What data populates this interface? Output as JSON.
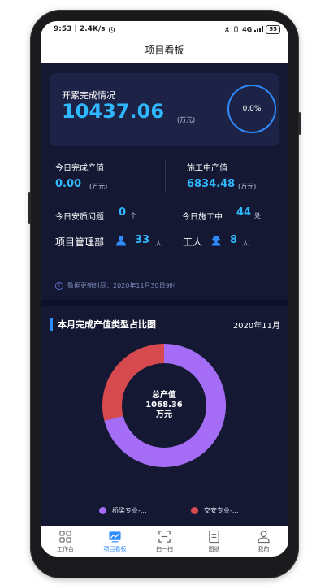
{
  "status_bar": {
    "time": "9:53 | 2.4K/s",
    "alarm_icon": "alarm-icon",
    "network": "4G",
    "battery": "55"
  },
  "title": "项目看板",
  "summary": {
    "label": "开累完成情况",
    "value": "10437.06",
    "unit": "(万元)",
    "percent": "0.0%"
  },
  "stats": {
    "today_output": {
      "label": "今日完成产值",
      "value": "0.00",
      "unit": "(万元)"
    },
    "in_progress_output": {
      "label": "施工中产值",
      "value": "6834.48",
      "unit": "(万元)"
    },
    "safety_issues": {
      "label": "今日安质问题",
      "value": "0",
      "unit": "个"
    },
    "today_construction": {
      "label": "今日施工中",
      "value": "44",
      "unit": "处"
    },
    "management": {
      "label": "项目管理部",
      "value": "33",
      "unit": "人"
    },
    "workers": {
      "label": "工人",
      "value": "8",
      "unit": "人"
    }
  },
  "update_info": "数据更新时间：2020年11月30日9时",
  "chart_section": {
    "title": "本月完成产值类型占比图",
    "date": "2020年11月"
  },
  "chart_data": {
    "type": "pie",
    "center_label": [
      "总产值",
      "1068.36",
      "万元"
    ],
    "series": [
      {
        "name": "桥梁专业-...",
        "value": 71,
        "color": "#a56cf5"
      },
      {
        "name": "交安专业-...",
        "value": 29,
        "color": "#d64a4f"
      }
    ]
  },
  "bottom_nav": [
    {
      "label": "工作台",
      "icon": "workbench-icon",
      "active": false
    },
    {
      "label": "项目看板",
      "icon": "dashboard-icon",
      "active": true
    },
    {
      "label": "扫一扫",
      "icon": "scan-icon",
      "active": false
    },
    {
      "label": "图纸",
      "icon": "drawing-icon",
      "active": false
    },
    {
      "label": "我的",
      "icon": "profile-icon",
      "active": false
    }
  ]
}
